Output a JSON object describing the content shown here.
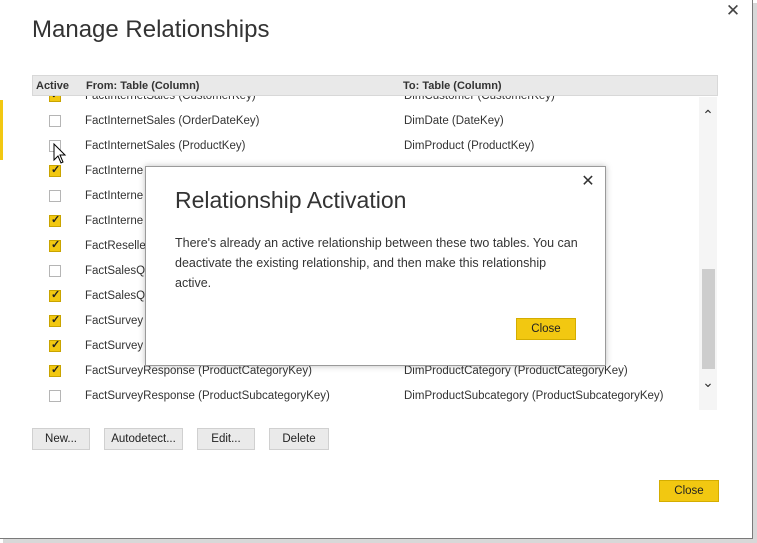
{
  "dialog": {
    "title": "Manage Relationships",
    "close_glyph": "✕"
  },
  "table": {
    "headers": {
      "active": "Active",
      "from": "From: Table (Column)",
      "to": "To: Table (Column)"
    },
    "rows": [
      {
        "active": true,
        "from": "FactInternetSales (CustomerKey)",
        "to": "DimCustomer (CustomerKey)"
      },
      {
        "active": false,
        "from": "FactInternetSales (OrderDateKey)",
        "to": "DimDate (DateKey)"
      },
      {
        "active": false,
        "from": "FactInternetSales (ProductKey)",
        "to": "DimProduct (ProductKey)"
      },
      {
        "active": true,
        "from": "FactInterne",
        "to": ""
      },
      {
        "active": false,
        "from": "FactInterne",
        "to": ""
      },
      {
        "active": true,
        "from": "FactInterne",
        "to": ""
      },
      {
        "active": true,
        "from": "FactReselle",
        "to": ""
      },
      {
        "active": false,
        "from": "FactSalesQu",
        "to": ""
      },
      {
        "active": true,
        "from": "FactSalesQu",
        "to": ""
      },
      {
        "active": true,
        "from": "FactSurvey",
        "to": ""
      },
      {
        "active": true,
        "from": "FactSurvey",
        "to": ""
      },
      {
        "active": true,
        "from": "FactSurveyResponse (ProductCategoryKey)",
        "to": "DimProductCategory (ProductCategoryKey)"
      },
      {
        "active": false,
        "from": "FactSurveyResponse (ProductSubcategoryKey)",
        "to": "DimProductSubcategory (ProductSubcategoryKey)"
      }
    ]
  },
  "scrollbar": {
    "up_glyph": "⌃",
    "down_glyph": "⌄"
  },
  "buttons": {
    "new": "New...",
    "autodetect": "Autodetect...",
    "edit": "Edit...",
    "delete": "Delete",
    "close": "Close"
  },
  "modal": {
    "title": "Relationship Activation",
    "close_glyph": "✕",
    "body": "There's already an active relationship between these two tables. You can deactivate the existing relationship, and then make this relationship active.",
    "close_button": "Close"
  },
  "colors": {
    "accent": "#f2c811",
    "header_bg": "#e9e9e9"
  }
}
